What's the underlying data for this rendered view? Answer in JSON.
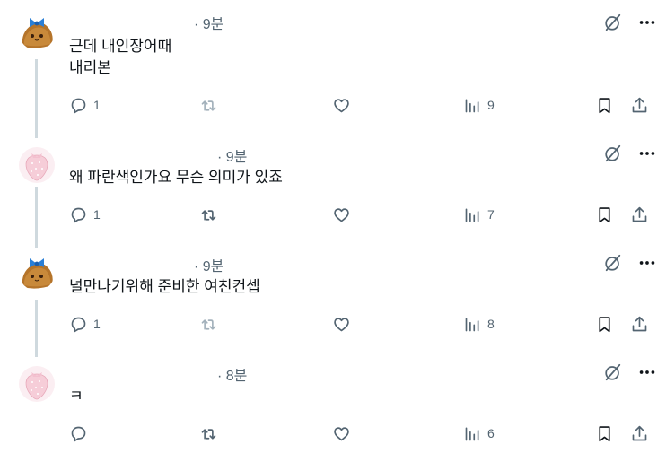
{
  "posts": [
    {
      "time": "· 9분",
      "text": "근데 내인장어때\n내리본",
      "avatar": "chestnut-with-blue-bow-avatar",
      "counts": {
        "reply": "1",
        "repost": "",
        "like": "",
        "views": "9"
      }
    },
    {
      "time": "· 9분",
      "text": "왜 파란색인가요 무슨 의미가 있죠",
      "avatar": "pink-strawberry-avatar",
      "counts": {
        "reply": "1",
        "repost": "",
        "like": "",
        "views": "7"
      }
    },
    {
      "time": "· 9분",
      "text": "널만나기위해 준비한 여친컨셉",
      "avatar": "chestnut-with-blue-bow-avatar",
      "counts": {
        "reply": "1",
        "repost": "",
        "like": "",
        "views": "8"
      }
    },
    {
      "time": "· 8분",
      "text": "ㅋ",
      "avatar": "pink-strawberry-avatar",
      "counts": {
        "reply": "",
        "repost": "",
        "like": "",
        "views": "6"
      }
    }
  ],
  "icons": {
    "grok": "grok-slash-icon",
    "more": "more-dots-icon",
    "reply": "reply-bubble-icon",
    "repost": "repost-arrows-icon",
    "like": "heart-icon",
    "views": "views-bars-icon",
    "bookmark": "bookmark-icon",
    "share": "share-upload-icon"
  },
  "colors": {
    "text": "#0f1419",
    "secondary": "#536471",
    "thread_line": "#cfd9de",
    "disabled_repost": "#a3b1bb"
  }
}
